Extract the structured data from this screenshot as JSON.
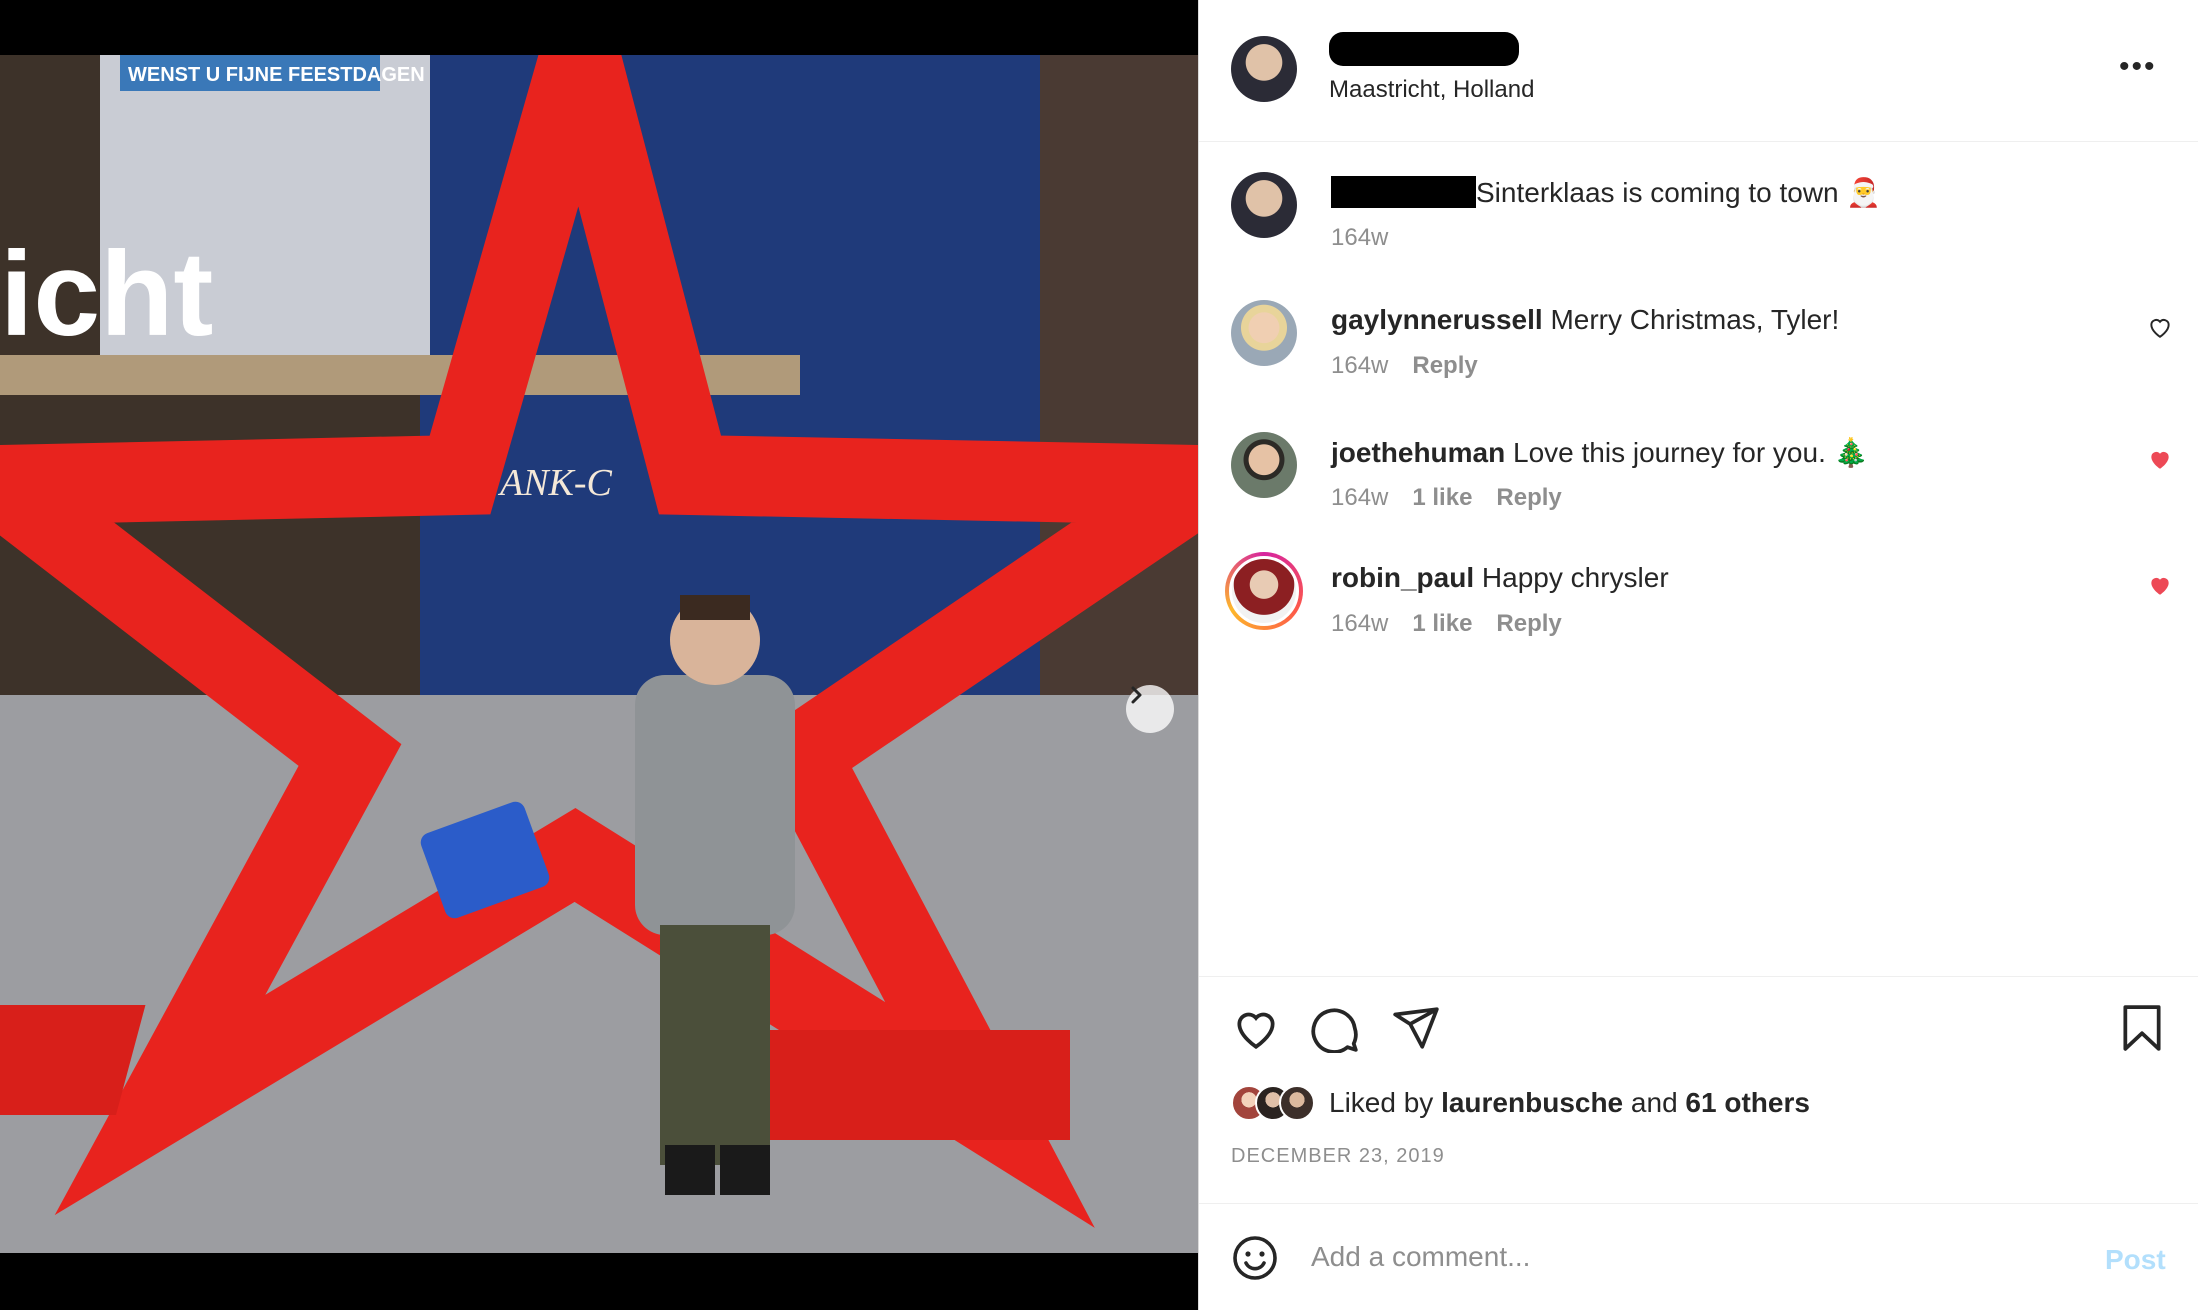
{
  "post": {
    "location": "Maastricht, Holland",
    "more_label": "•••"
  },
  "photo": {
    "sign_text": "WENST U FIJNE FEESTDAGEN",
    "station_text": "icht",
    "facade_text": "ANK-C",
    "carousel_total": 2,
    "carousel_active": 1
  },
  "caption": {
    "text": "Sinterklaas is coming to town 🎅",
    "time": "164w"
  },
  "comments": [
    {
      "user": "gaylynnerussell",
      "text": "Merry Christmas, Tyler!",
      "time": "164w",
      "likes": "",
      "reply": "Reply",
      "liked": false
    },
    {
      "user": "joethehuman",
      "text": "Love this journey for you. 🎄",
      "time": "164w",
      "likes": "1 like",
      "reply": "Reply",
      "liked": true
    },
    {
      "user": "robin_paul",
      "text": "Happy chrysler",
      "time": "164w",
      "likes": "1 like",
      "reply": "Reply",
      "liked": true
    }
  ],
  "likes": {
    "prefix": "Liked by",
    "user": "laurenbusche",
    "joiner": "and",
    "others": "61 others"
  },
  "date": "DECEMBER 23, 2019",
  "add_comment": {
    "placeholder": "Add a comment...",
    "post_label": "Post"
  },
  "colors": {
    "heart_red": "#ed4956",
    "link_blue_disabled": "#b2dffc",
    "muted": "#8e8e8e"
  }
}
